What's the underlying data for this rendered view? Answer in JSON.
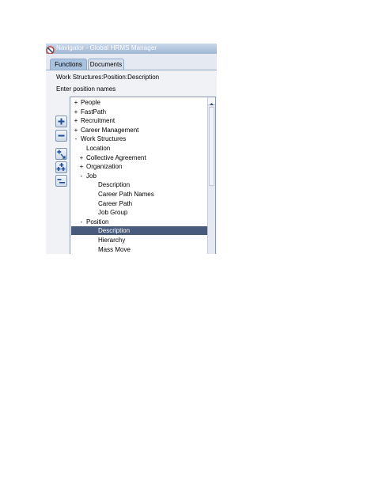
{
  "window": {
    "title": "Navigator - Global HRMS Manager"
  },
  "tabs": [
    {
      "label": "Functions",
      "active": true
    },
    {
      "label": "Documents",
      "active": false
    }
  ],
  "path_label": "Work Structures:Position:Description",
  "prompt_label": "Enter position names",
  "toolbar_icons": [
    "expand-icon",
    "collapse-icon",
    "expand-branch-icon",
    "expand-all-icon",
    "collapse-all-icon"
  ],
  "tree": [
    {
      "label": "People",
      "expander": "+",
      "level": 0,
      "selected": false
    },
    {
      "label": "FastPath",
      "expander": "+",
      "level": 0,
      "selected": false
    },
    {
      "label": "Recruitment",
      "expander": "+",
      "level": 0,
      "selected": false
    },
    {
      "label": "Career Management",
      "expander": "+",
      "level": 0,
      "selected": false
    },
    {
      "label": "Work Structures",
      "expander": "-",
      "level": 0,
      "selected": false
    },
    {
      "label": "Location",
      "expander": "",
      "level": 1,
      "selected": false
    },
    {
      "label": "Collective Agreement",
      "expander": "+",
      "level": 1,
      "selected": false
    },
    {
      "label": "Organization",
      "expander": "+",
      "level": 1,
      "selected": false
    },
    {
      "label": "Job",
      "expander": "-",
      "level": 1,
      "selected": false
    },
    {
      "label": "Description",
      "expander": "",
      "level": 2,
      "selected": false
    },
    {
      "label": "Career Path Names",
      "expander": "",
      "level": 2,
      "selected": false
    },
    {
      "label": "Career Path",
      "expander": "",
      "level": 2,
      "selected": false
    },
    {
      "label": "Job Group",
      "expander": "",
      "level": 2,
      "selected": false
    },
    {
      "label": "Position",
      "expander": "-",
      "level": 1,
      "selected": false
    },
    {
      "label": "Description",
      "expander": "",
      "level": 2,
      "selected": true
    },
    {
      "label": "Hierarchy",
      "expander": "",
      "level": 2,
      "selected": false
    },
    {
      "label": "Mass Move",
      "expander": "",
      "level": 2,
      "selected": false
    }
  ],
  "colors": {
    "selection": "#485b7c",
    "tab_active": "#a9c2df",
    "titlebar": "#9fb6d3"
  }
}
